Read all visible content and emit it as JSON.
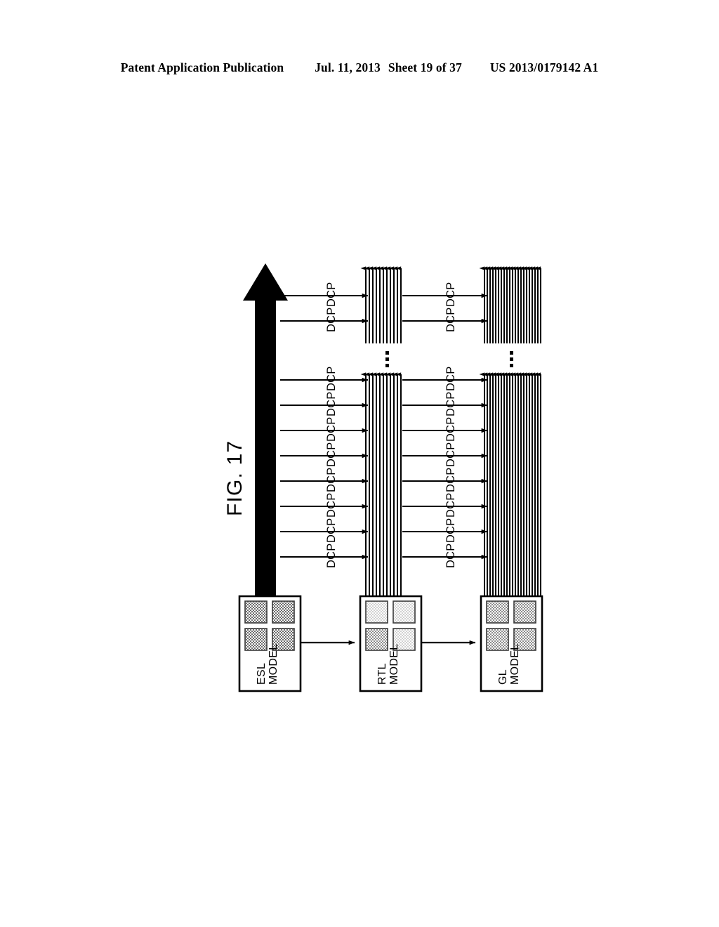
{
  "header": {
    "publication": "Patent Application Publication",
    "date": "Jul. 11, 2013",
    "sheet": "Sheet 19 of 37",
    "patent_number": "US 2013/0179142 A1"
  },
  "figure": {
    "title": "FIG. 17",
    "arrow_direction_icon": "up-arrow-icon",
    "ellipsis_glyph": "vertical-ellipsis-icon",
    "models": [
      {
        "id": "esl",
        "line1": "ESL",
        "line2": "MODEL",
        "cell_shade": "#8a8a8a"
      },
      {
        "id": "rtl",
        "line1": "RTL",
        "line2": "MODEL",
        "cell_shade": "#dcdcdc"
      },
      {
        "id": "gl",
        "line1": "GL",
        "line2": "MODEL",
        "cell_shade": "#9a9a9a"
      }
    ],
    "dcp_label": "DCP",
    "stage_columns": [
      {
        "id": "esl-to-rtl",
        "dcp_count_top": 2,
        "dcp_count_bottom": 8,
        "vertical_lines": 11
      },
      {
        "id": "rtl-to-gl",
        "dcp_count_top": 2,
        "dcp_count_bottom": 8,
        "vertical_lines": 21
      }
    ],
    "top_group_rows": 2,
    "bottom_group_rows": 8,
    "colors": {
      "line": "#000000",
      "background": "#ffffff",
      "box_border": "#000000"
    }
  }
}
